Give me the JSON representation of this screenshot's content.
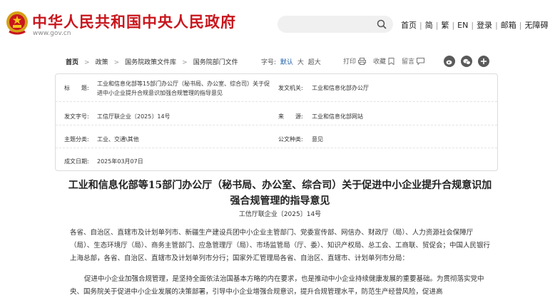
{
  "header": {
    "site_title": "中华人民共和国中央人民政府",
    "site_url": "www.gov.cn",
    "search_placeholder": "",
    "nav": [
      "首页",
      "简",
      "繁",
      "EN",
      "登录",
      "邮箱",
      "无障碍"
    ]
  },
  "breadcrumb": {
    "items": [
      "首页",
      "政策",
      "国务院政策文件库",
      "国务院部门文件"
    ]
  },
  "font_size": {
    "label": "字号:",
    "default": "默认",
    "large": "大",
    "xlarge": "超大"
  },
  "tools": {
    "print": "打印",
    "favorite": "收藏",
    "comment": "留言"
  },
  "info": {
    "title_label": "标　　题:",
    "title_value": "工业和信息化部等15部门办公厅（秘书局、办公室、综合司）关于促进中小企业提升合规意识加强合规管理的指导意见",
    "issuer_label": "发文机关:",
    "issuer_value": "工业和信息化部办公厅",
    "docno_label": "发文字号:",
    "docno_value": "工信厅联企业〔2025〕14号",
    "source_label": "来　　源:",
    "source_value": "工业和信息化部网站",
    "category_label": "主题分类:",
    "category_value": "工业、交通\\其他",
    "type_label": "公文种类:",
    "type_value": "意见",
    "date_label": "成文日期:",
    "date_value": "2025年03月07日"
  },
  "article": {
    "title": "工业和信息化部等15部门办公厅（秘书局、办公室、综合司）关于促进中小企业提升合规意识加强合规管理的指导意见",
    "doc_no": "工信厅联企业〔2025〕14号",
    "p1": "各省、自治区、直辖市及计划单列市、新疆生产建设兵团中小企业主管部门、党委宣传部、网信办、财政厅（局）、人力资源社会保障厅（局）、生态环境厅（局）、商务主管部门、应急管理厅（局）、市场监管局（厅、委）、知识产权局、总工会、工商联、贸促会；中国人民银行上海总部，各省、自治区、直辖市及计划单列市分行；国家外汇管理局各省、自治区、直辖市、计划单列市分局：",
    "p2": "促进中小企业加强合规管理，是坚持全面依法治国基本方略的内在要求，也是推动中小企业持续健康发展的重要基础。为贯彻落实党中央、国务院关于促进中小企业发展的决策部署，引导中小企业增强合规意识，提升合规管理水平，防范生产经营风险，促进高"
  },
  "colors": {
    "brand_red": "#c8161d",
    "link_blue": "#1a5ca8"
  }
}
